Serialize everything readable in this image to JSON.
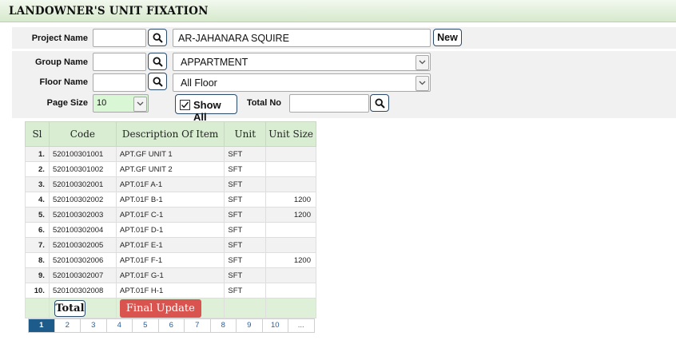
{
  "header": {
    "title": "LANDOWNER'S UNIT FIXATION"
  },
  "form": {
    "project": {
      "label": "Project Name",
      "code_value": "",
      "name_value": "AR-JAHANARA SQUIRE",
      "new_label": "New"
    },
    "group": {
      "label": "Group Name",
      "code_value": "",
      "selected": "APPARTMENT"
    },
    "floor": {
      "label": "Floor Name",
      "code_value": "",
      "selected": "All Floor"
    },
    "page_size": {
      "label": "Page Size",
      "selected": "10"
    },
    "show_all": {
      "label": "Show All",
      "checked": true
    },
    "total_no": {
      "label": "Total No",
      "value": ""
    }
  },
  "grid": {
    "columns": [
      "Sl",
      "Code",
      "Description Of Item",
      "Unit",
      "Unit Size"
    ],
    "rows": [
      {
        "sl": "1.",
        "code": "520100301001",
        "desc": "APT.GF UNIT 1",
        "unit": "SFT",
        "size": ""
      },
      {
        "sl": "2.",
        "code": "520100301002",
        "desc": "APT.GF UNIT 2",
        "unit": "SFT",
        "size": ""
      },
      {
        "sl": "3.",
        "code": "520100302001",
        "desc": "APT.01F A-1",
        "unit": "SFT",
        "size": ""
      },
      {
        "sl": "4.",
        "code": "520100302002",
        "desc": "APT.01F B-1",
        "unit": "SFT",
        "size": "1200"
      },
      {
        "sl": "5.",
        "code": "520100302003",
        "desc": "APT.01F C-1",
        "unit": "SFT",
        "size": "1200"
      },
      {
        "sl": "6.",
        "code": "520100302004",
        "desc": "APT.01F D-1",
        "unit": "SFT",
        "size": ""
      },
      {
        "sl": "7.",
        "code": "520100302005",
        "desc": "APT.01F E-1",
        "unit": "SFT",
        "size": ""
      },
      {
        "sl": "8.",
        "code": "520100302006",
        "desc": "APT.01F F-1",
        "unit": "SFT",
        "size": "1200"
      },
      {
        "sl": "9.",
        "code": "520100302007",
        "desc": "APT.01F G-1",
        "unit": "SFT",
        "size": ""
      },
      {
        "sl": "10.",
        "code": "520100302008",
        "desc": "APT.01F H-1",
        "unit": "SFT",
        "size": ""
      }
    ],
    "footer": {
      "total_label": "Total",
      "final_update_label": "Final Update"
    }
  },
  "pager": {
    "pages": [
      "1",
      "2",
      "3",
      "4",
      "5",
      "6",
      "7",
      "8",
      "9",
      "10",
      "..."
    ],
    "current": "1"
  },
  "icons": {
    "search": "search-icon",
    "dropdown": "chevron-down-icon",
    "checkbox": "checkbox-checked-icon"
  },
  "colors": {
    "header_green": "#d6e9cd",
    "grid_header": "#d8edd1",
    "final_update_red": "#d9534f",
    "pager_active": "#1d5c8a"
  }
}
